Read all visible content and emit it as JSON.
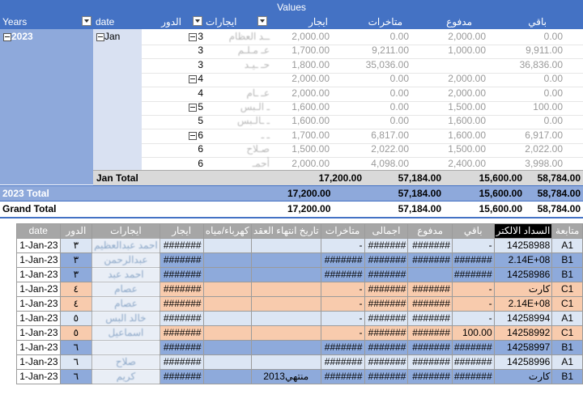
{
  "pivot": {
    "values_label": "Values",
    "headers": {
      "years": "Years",
      "date": "date",
      "daw": "الدور",
      "ejarat": "ايجارات",
      "ejar": "ايجار",
      "mota": "متاخرات",
      "madfoo": "مدفوع",
      "baqi": "باقي"
    },
    "year": "2023",
    "month": "Jan",
    "rows": [
      {
        "daw": "3",
        "name": "ــد العظام",
        "ejar": "2,000.00",
        "mota": "0.00",
        "madfoo": "2,000.00",
        "baqi": "0.00",
        "collapse": true
      },
      {
        "daw": "3",
        "name": "عـ مـلـم",
        "ejar": "1,700.00",
        "mota": "9,211.00",
        "madfoo": "1,000.00",
        "baqi": "9,911.00",
        "collapse": false
      },
      {
        "daw": "3",
        "name": "حـ ـيـد",
        "ejar": "1,800.00",
        "mota": "35,036.00",
        "madfoo": "",
        "baqi": "36,836.00",
        "collapse": false
      },
      {
        "daw": "4",
        "name": "",
        "ejar": "2,000.00",
        "mota": "0.00",
        "madfoo": "2,000.00",
        "baqi": "0.00",
        "collapse": true
      },
      {
        "daw": "4",
        "name": "عـ ـام",
        "ejar": "2,000.00",
        "mota": "0.00",
        "madfoo": "2,000.00",
        "baqi": "0.00",
        "collapse": false
      },
      {
        "daw": "5",
        "name": "ـ الـبس",
        "ejar": "1,600.00",
        "mota": "0.00",
        "madfoo": "1,500.00",
        "baqi": "100.00",
        "collapse": true
      },
      {
        "daw": "5",
        "name": "ـ ـالـبس",
        "ejar": "1,600.00",
        "mota": "0.00",
        "madfoo": "1,600.00",
        "baqi": "0.00",
        "collapse": false
      },
      {
        "daw": "6",
        "name": "ـ ـ",
        "ejar": "1,700.00",
        "mota": "6,817.00",
        "madfoo": "1,600.00",
        "baqi": "6,917.00",
        "collapse": true
      },
      {
        "daw": "6",
        "name": "صـلاح",
        "ejar": "1,500.00",
        "mota": "2,022.00",
        "madfoo": "1,500.00",
        "baqi": "2,022.00",
        "collapse": false
      },
      {
        "daw": "6",
        "name": "أحمـ",
        "ejar": "2,000.00",
        "mota": "4,098.00",
        "madfoo": "2,400.00",
        "baqi": "3,998.00",
        "collapse": false
      }
    ],
    "jan_total": {
      "label": "Jan Total",
      "ejar": "17,200.00",
      "mota": "57,184.00",
      "madfoo": "15,600.00",
      "baqi": "58,784.00"
    },
    "year_total": {
      "label": "2023 Total",
      "ejar": "17,200.00",
      "mota": "57,184.00",
      "madfoo": "15,600.00",
      "baqi": "58,784.00"
    },
    "grand_total": {
      "label": "Grand Total",
      "ejar": "17,200.00",
      "mota": "57,184.00",
      "madfoo": "15,600.00",
      "baqi": "58,784.00"
    }
  },
  "table": {
    "headers": [
      "date",
      "الدور",
      "ايجارات",
      "ايجار",
      "كهرباء/مياه",
      "تاريخ انتهاء العقد",
      "متاخرات",
      "اجمالى",
      "مدفوع",
      "باقي",
      "السداد الالكتر",
      "متابعة"
    ],
    "rows": [
      {
        "date": "1-Jan-23",
        "daw": "٣",
        "name": "احمد عبدالعظيم",
        "ejar": "#######",
        "kahraba": "",
        "end": "",
        "mota": "-",
        "egmali": "#######",
        "madfoo": "#######",
        "baqi": "-",
        "sadad": "14258988",
        "mt": "A1",
        "bg": "#dce6f4"
      },
      {
        "date": "1-Jan-23",
        "daw": "٣",
        "name": "عبدالرحمن",
        "ejar": "#######",
        "kahraba": "",
        "end": "",
        "mota": "#######",
        "egmali": "#######",
        "madfoo": "#######",
        "baqi": "#######",
        "sadad": "2.14E+08",
        "mt": "B1",
        "bg": "#8eaadb"
      },
      {
        "date": "1-Jan-23",
        "daw": "٣",
        "name": "احمد عبد",
        "ejar": "#######",
        "kahraba": "",
        "end": "",
        "mota": "#######",
        "egmali": "#######",
        "madfoo": "",
        "baqi": "#######",
        "sadad": "14258986",
        "mt": "B1",
        "bg": "#8eaadb"
      },
      {
        "date": "1-Jan-23",
        "daw": "٤",
        "name": "عصام",
        "ejar": "#######",
        "kahraba": "",
        "end": "",
        "mota": "-",
        "egmali": "#######",
        "madfoo": "#######",
        "baqi": "-",
        "sadad": "كارت",
        "mt": "C1",
        "bg": "#f8cbad"
      },
      {
        "date": "1-Jan-23",
        "daw": "٤",
        "name": "عصام",
        "ejar": "#######",
        "kahraba": "",
        "end": "",
        "mota": "-",
        "egmali": "#######",
        "madfoo": "#######",
        "baqi": "-",
        "sadad": "2.14E+08",
        "mt": "C1",
        "bg": "#f8cbad"
      },
      {
        "date": "1-Jan-23",
        "daw": "٥",
        "name": "خالد البس",
        "ejar": "#######",
        "kahraba": "",
        "end": "",
        "mota": "-",
        "egmali": "#######",
        "madfoo": "#######",
        "baqi": "-",
        "sadad": "14258994",
        "mt": "A1",
        "bg": "#dce6f4"
      },
      {
        "date": "1-Jan-23",
        "daw": "٥",
        "name": "اسماعيل",
        "ejar": "#######",
        "kahraba": "",
        "end": "",
        "mota": "-",
        "egmali": "#######",
        "madfoo": "#######",
        "baqi": "100.00",
        "sadad": "14258992",
        "mt": "C1",
        "bg": "#f8cbad"
      },
      {
        "date": "1-Jan-23",
        "daw": "٦",
        "name": "",
        "ejar": "#######",
        "kahraba": "",
        "end": "",
        "mota": "#######",
        "egmali": "#######",
        "madfoo": "#######",
        "baqi": "#######",
        "sadad": "14258997",
        "mt": "B1",
        "bg": "#8eaadb"
      },
      {
        "date": "1-Jan-23",
        "daw": "٦",
        "name": "صلاح",
        "ejar": "#######",
        "kahraba": "",
        "end": "",
        "mota": "#######",
        "egmali": "#######",
        "madfoo": "#######",
        "baqi": "#######",
        "sadad": "14258996",
        "mt": "A1",
        "bg": "#dce6f4"
      },
      {
        "date": "1-Jan-23",
        "daw": "٦",
        "name": "كريم",
        "ejar": "#######",
        "kahraba": "",
        "end": "منتهي2013",
        "mota": "#######",
        "egmali": "#######",
        "madfoo": "#######",
        "baqi": "#######",
        "sadad": "كارت",
        "mt": "B1",
        "bg": "#8eaadb"
      }
    ]
  }
}
